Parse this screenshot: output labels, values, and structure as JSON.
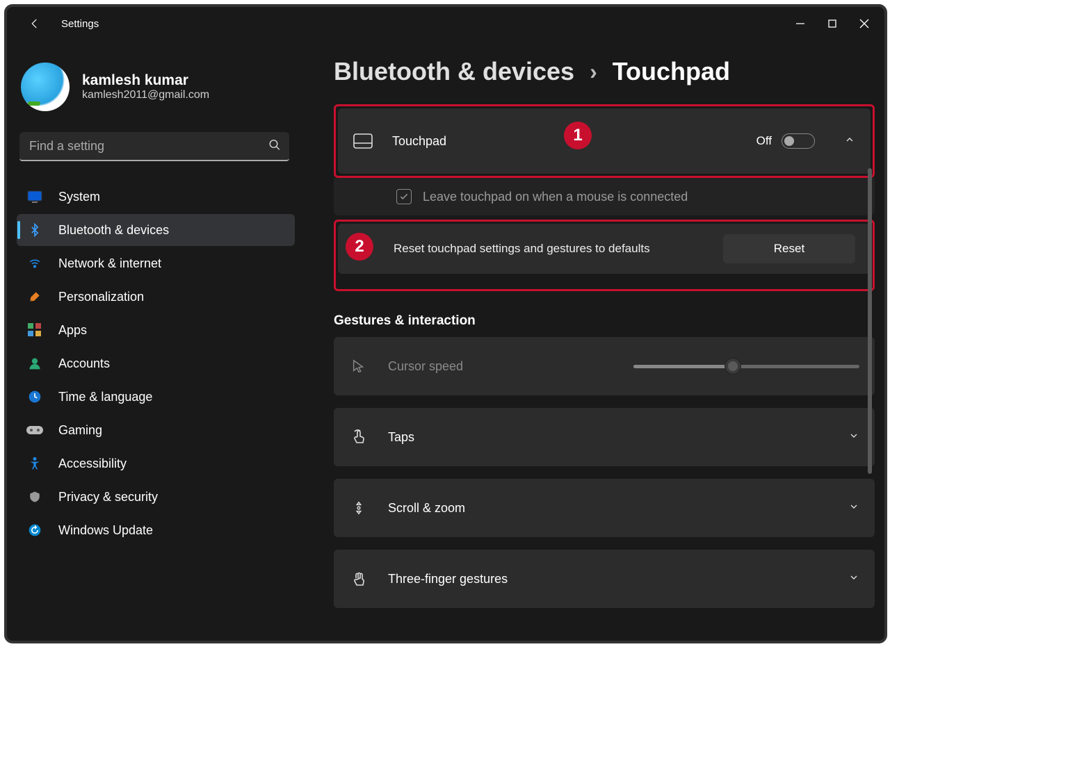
{
  "app_title": "Settings",
  "user": {
    "name": "kamlesh kumar",
    "email": "kamlesh2011@gmail.com"
  },
  "search": {
    "placeholder": "Find a setting"
  },
  "sidebar": {
    "items": [
      {
        "label": "System"
      },
      {
        "label": "Bluetooth & devices"
      },
      {
        "label": "Network & internet"
      },
      {
        "label": "Personalization"
      },
      {
        "label": "Apps"
      },
      {
        "label": "Accounts"
      },
      {
        "label": "Time & language"
      },
      {
        "label": "Gaming"
      },
      {
        "label": "Accessibility"
      },
      {
        "label": "Privacy & security"
      },
      {
        "label": "Windows Update"
      }
    ]
  },
  "breadcrumb": {
    "parent": "Bluetooth & devices",
    "current": "Touchpad"
  },
  "touchpad": {
    "label": "Touchpad",
    "state": "Off",
    "option_label": "Leave touchpad on when a mouse is connected",
    "reset_text": "Reset touchpad settings and gestures to defaults",
    "reset_btn": "Reset"
  },
  "gestures": {
    "section_title": "Gestures & interaction",
    "cursor_speed": "Cursor speed",
    "taps": "Taps",
    "scroll_zoom": "Scroll & zoom",
    "three_finger": "Three-finger gestures"
  },
  "annotations": {
    "badge1": "1",
    "badge2": "2"
  }
}
